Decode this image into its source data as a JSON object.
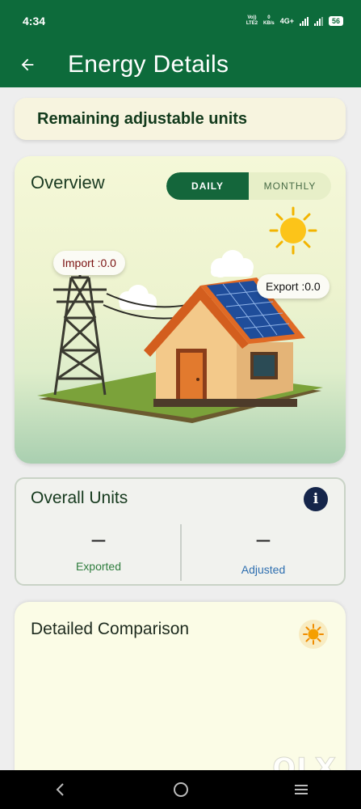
{
  "status_bar": {
    "time": "4:34",
    "volte": "Vo))",
    "lte": "LTE2",
    "data_speed": "0",
    "data_unit": "KB/s",
    "network": "4G+",
    "battery": "56"
  },
  "app_bar": {
    "title": "Energy Details",
    "back_icon": "arrow-left-icon"
  },
  "remaining": {
    "label": "Remaining adjustable units"
  },
  "overview": {
    "title": "Overview",
    "tabs": [
      {
        "label": "DAILY",
        "active": true
      },
      {
        "label": "MONTHLY",
        "active": false
      }
    ],
    "import_label": "Import :0.0",
    "export_label": "Export :0.0"
  },
  "overall_units": {
    "title": "Overall Units",
    "info_icon": "info-icon",
    "info_glyph": "i",
    "exported": {
      "value": "–",
      "label": "Exported"
    },
    "adjusted": {
      "value": "–",
      "label": "Adjusted"
    }
  },
  "detailed": {
    "title": "Detailed Comparison",
    "icon": "sun-icon"
  },
  "watermark": "OLX",
  "colors": {
    "primary": "#0d6b3b",
    "info": "#15254a",
    "exported_text": "#2f7d3e",
    "adjusted_text": "#2f6fb0",
    "import_text": "#7a1010"
  }
}
